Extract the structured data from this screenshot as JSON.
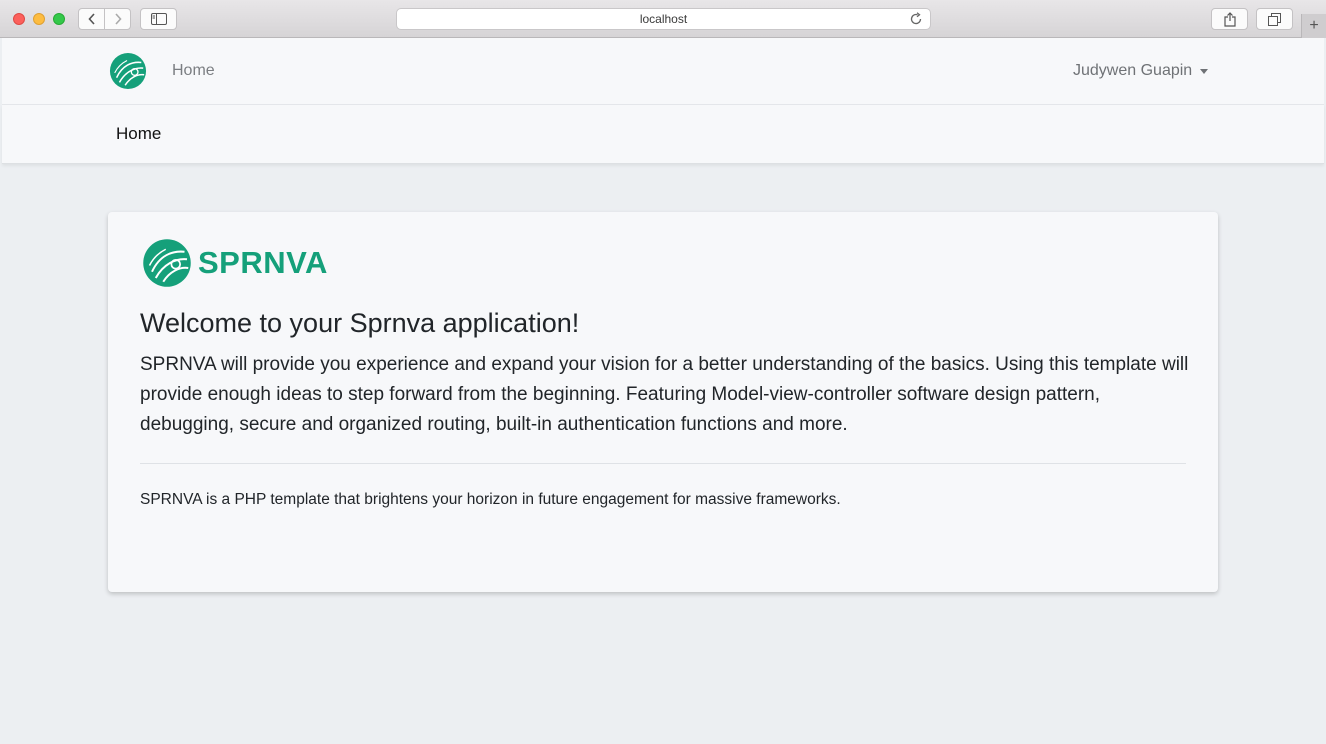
{
  "browser": {
    "url": "localhost",
    "new_tab_label": "+"
  },
  "topnav": {
    "home_label": "Home",
    "user_name": "Judywen Guapin"
  },
  "subheader": {
    "title": "Home"
  },
  "card": {
    "brand_name": "SPRNVA",
    "headline": "Welcome to your Sprnva application!",
    "lead": "SPRNVA will provide you experience and expand your vision for a better understanding of the basics. Using this template will provide enough ideas to step forward from the beginning. Featuring Model-view-controller software design pattern, debugging, secure and organized routing, built-in authentication functions and more.",
    "note": "SPRNVA is a PHP template that brightens your horizon in future engagement for massive frameworks."
  },
  "colors": {
    "brand_green": "#15a07a",
    "page_bg": "#eceff2",
    "card_bg": "#f7f8fa"
  }
}
